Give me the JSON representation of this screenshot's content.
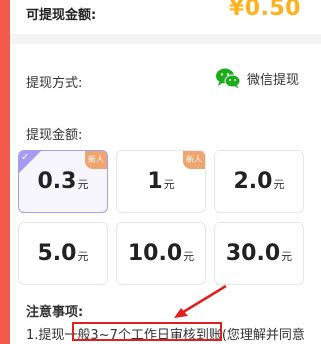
{
  "balance": {
    "label": "可提现金额:",
    "value": "¥0.50"
  },
  "method": {
    "label": "提现方式:",
    "option_label": "微信提现",
    "option_icon": "wechat-icon"
  },
  "amount": {
    "title": "提现金额:",
    "options": [
      {
        "value": "0.3",
        "unit": "元",
        "selected": true,
        "badge": "新人"
      },
      {
        "value": "1",
        "unit": "元",
        "selected": false,
        "badge": "新人"
      },
      {
        "value": "2.0",
        "unit": "元",
        "selected": false,
        "badge": ""
      },
      {
        "value": "5.0",
        "unit": "元",
        "selected": false,
        "badge": ""
      },
      {
        "value": "10.0",
        "unit": "元",
        "selected": false,
        "badge": ""
      },
      {
        "value": "30.0",
        "unit": "元",
        "selected": false,
        "badge": ""
      }
    ]
  },
  "notes": {
    "title": "注意事项:",
    "line1_prefix": "1.提现",
    "line1_highlight": "一般3~7个工作日审核到账",
    "line1_suffix": "(您理解并同意"
  },
  "colors": {
    "accent": "#f35a4b",
    "balance": "#ffb21a",
    "selected_border": "#a99cf3",
    "badge": "#f0a46e"
  }
}
